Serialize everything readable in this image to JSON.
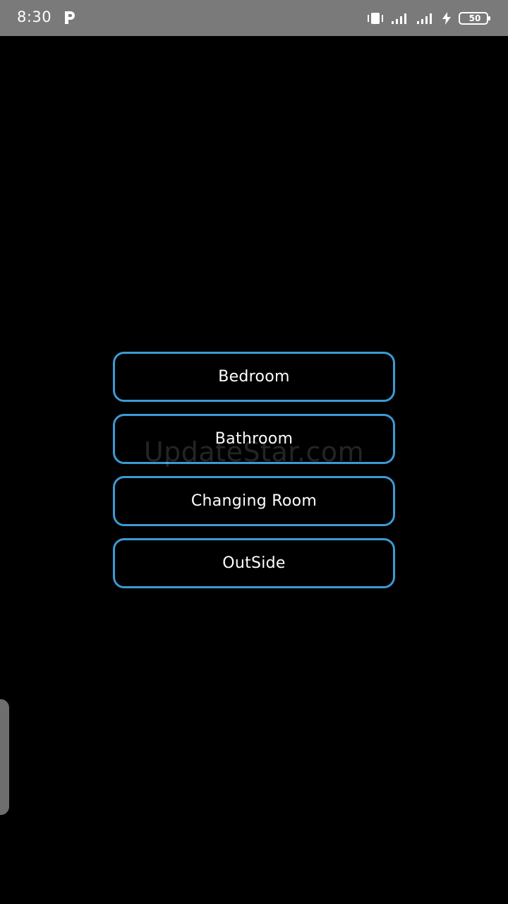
{
  "status_bar": {
    "time": "8:30",
    "battery_level": "50",
    "icons": [
      "p-app-icon",
      "vibrate-icon",
      "signal-icon",
      "signal-icon",
      "charging-icon",
      "battery-icon"
    ]
  },
  "menu": {
    "items": [
      {
        "label": "Bedroom"
      },
      {
        "label": "Bathroom"
      },
      {
        "label": "Changing Room"
      },
      {
        "label": "OutSide"
      }
    ]
  },
  "watermark": "UpdateStar.com",
  "colors": {
    "background": "#000000",
    "button_border": "#3b9ad4",
    "status_bar": "#7a7a7a"
  }
}
